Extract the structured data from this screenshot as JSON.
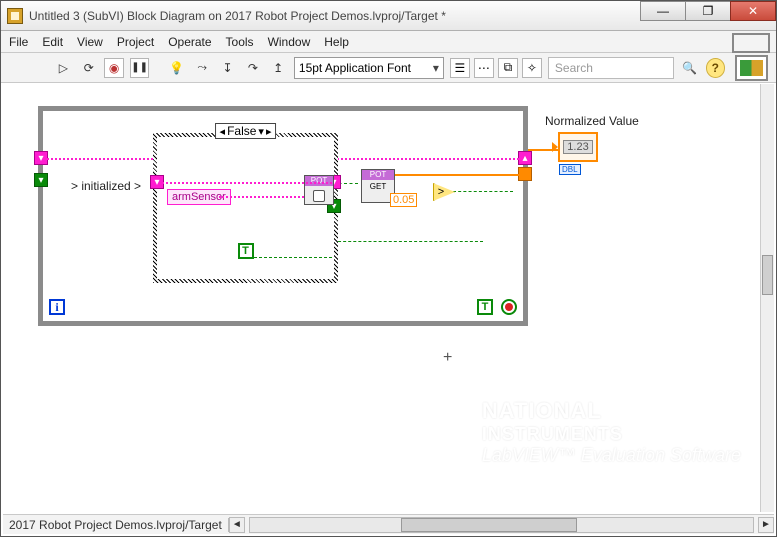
{
  "titlebar": {
    "title": "Untitled 3 (SubVI) Block Diagram on 2017 Robot Project Demos.lvproj/Target *"
  },
  "window_buttons": {
    "min": "—",
    "max": "❐",
    "close": "✕"
  },
  "menu": {
    "file": "File",
    "edit": "Edit",
    "view": "View",
    "project": "Project",
    "operate": "Operate",
    "tools": "Tools",
    "window": "Window",
    "help": "Help"
  },
  "toolbar": {
    "font": "15pt Application Font",
    "search_placeholder": "Search",
    "help": "?"
  },
  "diagram": {
    "init_label": "> initialized >",
    "case_value": "False",
    "sensor_control": "armSensor",
    "pot_open_header": "POT",
    "pot_get_header": "POT",
    "pot_get_label": "GET",
    "threshold_const": "0.05",
    "compare_op": ">",
    "true_const_inner": "T",
    "true_const_outer": "T",
    "iteration": "i",
    "normalized_label": "Normalized Value",
    "indicator_placeholder": "1.23",
    "dbl_tag": "DBL"
  },
  "watermark": {
    "line1": "NATIONAL",
    "line2": "INSTRUMENTS",
    "line3": "LabVIEW™ Evaluation Software"
  },
  "statusbar": {
    "path": "2017 Robot Project Demos.lvproj/Target",
    "hscroll_left": "◄",
    "hscroll_right": "►",
    "hscroll_grip": "⋮⋮⋮"
  }
}
